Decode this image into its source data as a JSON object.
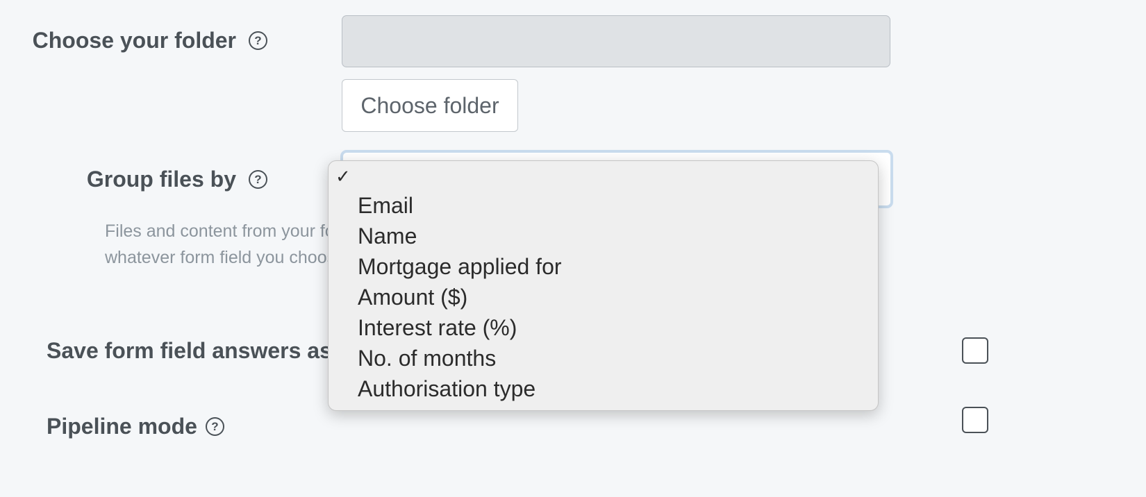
{
  "folder": {
    "label": "Choose your folder",
    "input_value": "",
    "button_label": "Choose folder"
  },
  "group": {
    "label": "Group files by",
    "help_line1": "Files and content from your form submissions can be organised into subfolders by",
    "help_line2": "whatever form field you choose."
  },
  "save_answers": {
    "label": "Save form field answers as",
    "checked": false
  },
  "pipeline": {
    "label": "Pipeline mode",
    "checked": false
  },
  "dropdown": {
    "check_mark": "✓",
    "selected": "",
    "options": [
      "Email",
      "Name",
      "Mortgage applied for",
      "Amount ($)",
      "Interest rate (%)",
      "No. of months",
      "Authorisation type"
    ]
  },
  "icons": {
    "help": "help-circle-icon",
    "check": "checkmark-icon"
  },
  "colors": {
    "background": "#f5f7f9",
    "label_text": "#4a5157",
    "help_text": "#8c959d",
    "disabled_input": "#dfe2e5",
    "focus_ring": "#c9dcee",
    "dropdown_bg": "#efefef"
  }
}
